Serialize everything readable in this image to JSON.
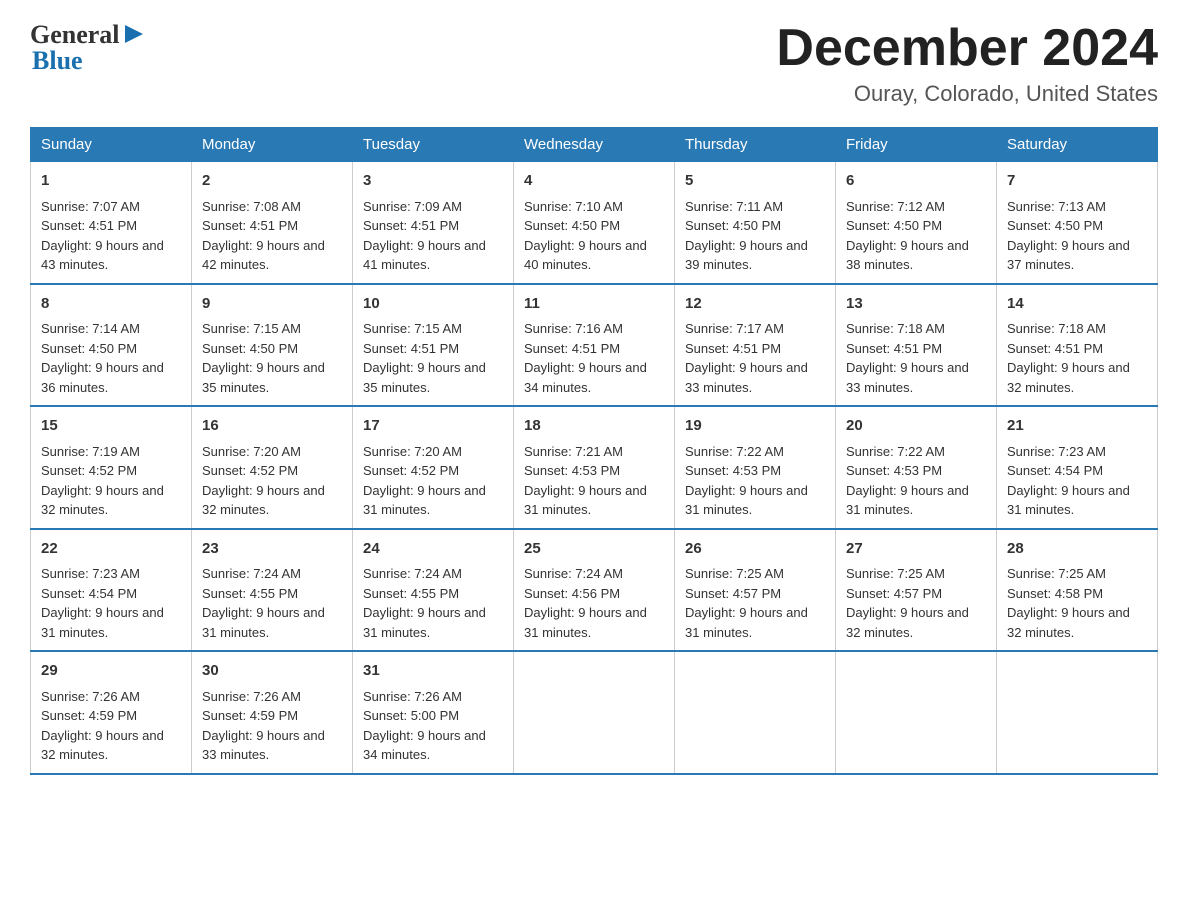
{
  "logo": {
    "line1": "General",
    "line2": "Blue"
  },
  "title": "December 2024",
  "location": "Ouray, Colorado, United States",
  "days_of_week": [
    "Sunday",
    "Monday",
    "Tuesday",
    "Wednesday",
    "Thursday",
    "Friday",
    "Saturday"
  ],
  "weeks": [
    [
      {
        "day": "1",
        "sunrise": "7:07 AM",
        "sunset": "4:51 PM",
        "daylight": "9 hours and 43 minutes."
      },
      {
        "day": "2",
        "sunrise": "7:08 AM",
        "sunset": "4:51 PM",
        "daylight": "9 hours and 42 minutes."
      },
      {
        "day": "3",
        "sunrise": "7:09 AM",
        "sunset": "4:51 PM",
        "daylight": "9 hours and 41 minutes."
      },
      {
        "day": "4",
        "sunrise": "7:10 AM",
        "sunset": "4:50 PM",
        "daylight": "9 hours and 40 minutes."
      },
      {
        "day": "5",
        "sunrise": "7:11 AM",
        "sunset": "4:50 PM",
        "daylight": "9 hours and 39 minutes."
      },
      {
        "day": "6",
        "sunrise": "7:12 AM",
        "sunset": "4:50 PM",
        "daylight": "9 hours and 38 minutes."
      },
      {
        "day": "7",
        "sunrise": "7:13 AM",
        "sunset": "4:50 PM",
        "daylight": "9 hours and 37 minutes."
      }
    ],
    [
      {
        "day": "8",
        "sunrise": "7:14 AM",
        "sunset": "4:50 PM",
        "daylight": "9 hours and 36 minutes."
      },
      {
        "day": "9",
        "sunrise": "7:15 AM",
        "sunset": "4:50 PM",
        "daylight": "9 hours and 35 minutes."
      },
      {
        "day": "10",
        "sunrise": "7:15 AM",
        "sunset": "4:51 PM",
        "daylight": "9 hours and 35 minutes."
      },
      {
        "day": "11",
        "sunrise": "7:16 AM",
        "sunset": "4:51 PM",
        "daylight": "9 hours and 34 minutes."
      },
      {
        "day": "12",
        "sunrise": "7:17 AM",
        "sunset": "4:51 PM",
        "daylight": "9 hours and 33 minutes."
      },
      {
        "day": "13",
        "sunrise": "7:18 AM",
        "sunset": "4:51 PM",
        "daylight": "9 hours and 33 minutes."
      },
      {
        "day": "14",
        "sunrise": "7:18 AM",
        "sunset": "4:51 PM",
        "daylight": "9 hours and 32 minutes."
      }
    ],
    [
      {
        "day": "15",
        "sunrise": "7:19 AM",
        "sunset": "4:52 PM",
        "daylight": "9 hours and 32 minutes."
      },
      {
        "day": "16",
        "sunrise": "7:20 AM",
        "sunset": "4:52 PM",
        "daylight": "9 hours and 32 minutes."
      },
      {
        "day": "17",
        "sunrise": "7:20 AM",
        "sunset": "4:52 PM",
        "daylight": "9 hours and 31 minutes."
      },
      {
        "day": "18",
        "sunrise": "7:21 AM",
        "sunset": "4:53 PM",
        "daylight": "9 hours and 31 minutes."
      },
      {
        "day": "19",
        "sunrise": "7:22 AM",
        "sunset": "4:53 PM",
        "daylight": "9 hours and 31 minutes."
      },
      {
        "day": "20",
        "sunrise": "7:22 AM",
        "sunset": "4:53 PM",
        "daylight": "9 hours and 31 minutes."
      },
      {
        "day": "21",
        "sunrise": "7:23 AM",
        "sunset": "4:54 PM",
        "daylight": "9 hours and 31 minutes."
      }
    ],
    [
      {
        "day": "22",
        "sunrise": "7:23 AM",
        "sunset": "4:54 PM",
        "daylight": "9 hours and 31 minutes."
      },
      {
        "day": "23",
        "sunrise": "7:24 AM",
        "sunset": "4:55 PM",
        "daylight": "9 hours and 31 minutes."
      },
      {
        "day": "24",
        "sunrise": "7:24 AM",
        "sunset": "4:55 PM",
        "daylight": "9 hours and 31 minutes."
      },
      {
        "day": "25",
        "sunrise": "7:24 AM",
        "sunset": "4:56 PM",
        "daylight": "9 hours and 31 minutes."
      },
      {
        "day": "26",
        "sunrise": "7:25 AM",
        "sunset": "4:57 PM",
        "daylight": "9 hours and 31 minutes."
      },
      {
        "day": "27",
        "sunrise": "7:25 AM",
        "sunset": "4:57 PM",
        "daylight": "9 hours and 32 minutes."
      },
      {
        "day": "28",
        "sunrise": "7:25 AM",
        "sunset": "4:58 PM",
        "daylight": "9 hours and 32 minutes."
      }
    ],
    [
      {
        "day": "29",
        "sunrise": "7:26 AM",
        "sunset": "4:59 PM",
        "daylight": "9 hours and 32 minutes."
      },
      {
        "day": "30",
        "sunrise": "7:26 AM",
        "sunset": "4:59 PM",
        "daylight": "9 hours and 33 minutes."
      },
      {
        "day": "31",
        "sunrise": "7:26 AM",
        "sunset": "5:00 PM",
        "daylight": "9 hours and 34 minutes."
      },
      null,
      null,
      null,
      null
    ]
  ],
  "labels": {
    "sunrise": "Sunrise: ",
    "sunset": "Sunset: ",
    "daylight": "Daylight: "
  }
}
